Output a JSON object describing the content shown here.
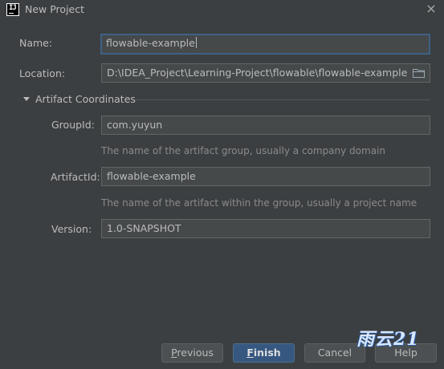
{
  "window": {
    "title": "New Project",
    "close_glyph": "×"
  },
  "form": {
    "name_label": "Name:",
    "name_value": "flowable-example",
    "location_label": "Location:",
    "location_value": "D:\\IDEA_Project\\Learning-Project\\flowable\\flowable-example",
    "artifact_section": "Artifact Coordinates",
    "groupid_label": "GroupId:",
    "groupid_value": "com.yuyun",
    "groupid_hint": "The name of the artifact group, usually a company domain",
    "artifactid_label": "ArtifactId:",
    "artifactid_value": "flowable-example",
    "artifactid_hint": "The name of the artifact within the group, usually a project name",
    "version_label": "Version:",
    "version_value": "1.0-SNAPSHOT"
  },
  "buttons": {
    "previous_first": "P",
    "previous_rest": "revious",
    "finish_first": "F",
    "finish_rest": "inish",
    "cancel": "Cancel",
    "help": "Help"
  },
  "watermark": "雨云21",
  "icons": {
    "app": "intellij-idea-icon",
    "folder": "folder-icon",
    "close": "close-icon",
    "expand": "triangle-down-icon"
  },
  "colors": {
    "background": "#3c3f41",
    "field_bg": "#45494a",
    "focus_border": "#3d6185",
    "primary_button": "#365880"
  }
}
